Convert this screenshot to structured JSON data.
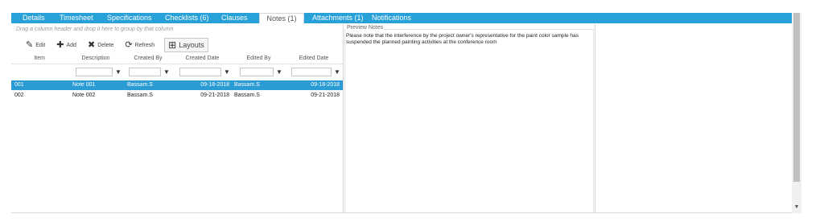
{
  "tabs": [
    {
      "label": "Details"
    },
    {
      "label": "Timesheet"
    },
    {
      "label": "Specifications"
    },
    {
      "label": "Checklists (6)"
    },
    {
      "label": "Clauses"
    },
    {
      "label": "Notes (1)"
    },
    {
      "label": "Attachments (1)"
    },
    {
      "label": "Notifications"
    }
  ],
  "active_tab": "Notes (1)",
  "grid": {
    "group_hint": "Drag a column header and drop it here to group by that column",
    "toolbar": {
      "edit": "Edit",
      "add": "Add",
      "delete": "Delete",
      "refresh": "Refresh",
      "layouts": "Layouts"
    },
    "columns": [
      "Item",
      "Description",
      "Created By",
      "Created Date",
      "Edited By",
      "Edited Date"
    ],
    "rows": [
      {
        "item": "001",
        "description": "Note 001",
        "created_by": "Bassam.S",
        "created_date": "09-18-2018",
        "edited_by": "Bassam.S",
        "edited_date": "09-18-2018",
        "selected": true
      },
      {
        "item": "002",
        "description": "Note 002",
        "created_by": "Bassam.S",
        "created_date": "09-21-2018",
        "edited_by": "Bassam.S",
        "edited_date": "09-21-2018",
        "selected": false
      }
    ]
  },
  "preview": {
    "label": "Preview Notes",
    "text": "Please note that the interference by the project owner's representative for the paint color sample has suspended the planned painting activities at the conference room"
  },
  "colors": {
    "accent": "#28a0d8",
    "selected_row": "#2a9bd3"
  },
  "icons": {
    "edit": "pencil-icon",
    "add": "plus-icon",
    "delete": "x-icon",
    "refresh": "refresh-icon",
    "layouts": "grid-icon",
    "filter": "filter-icon"
  }
}
